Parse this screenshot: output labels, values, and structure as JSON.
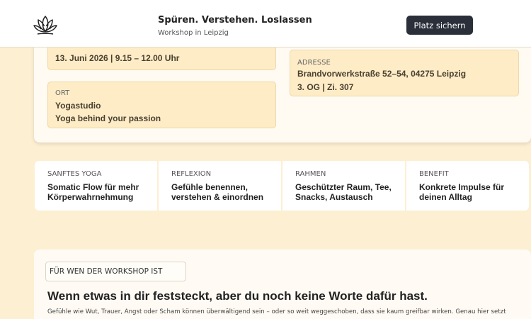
{
  "header": {
    "logo_icon": "lotus-icon",
    "title": "Spüren. Verstehen. Loslassen",
    "subtitle": "Workshop in Leipzig",
    "cta_label": "Platz sichern"
  },
  "info": {
    "date_value": "13. Juni 2026 | 9.15 – 12.00 Uhr",
    "location": {
      "label": "ORT",
      "line1": "Yogastudio",
      "line2": "Yoga behind your passion"
    },
    "address": {
      "label": "ADRESSE",
      "line1": "Brandvorwerkstraße 52–54, 04275 Leipzig",
      "line2": "3. OG | Zi. 307"
    }
  },
  "features": [
    {
      "label": "SANFTES YOGA",
      "text": "Somatic Flow für mehr Körperwahrnehmung"
    },
    {
      "label": "REFLEXION",
      "text": "Gefühle benennen, verstehen & einordnen"
    },
    {
      "label": "RAHMEN",
      "text": "Geschützter Raum, Tee, Snacks, Austausch"
    },
    {
      "label": "BENEFIT",
      "text": "Konkrete Impulse für deinen Alltag"
    }
  ],
  "section": {
    "pill": "FÜR WEN DER WORKSHOP IST",
    "heading": "Wenn etwas in dir feststeckt, aber du noch keine Worte dafür hast.",
    "body": "Gefühle wie Wut, Trauer, Angst oder Scham können überwältigend sein – oder so weit weggeschoben, dass sie kaum greifbar wirken. Genau hier setzt"
  }
}
